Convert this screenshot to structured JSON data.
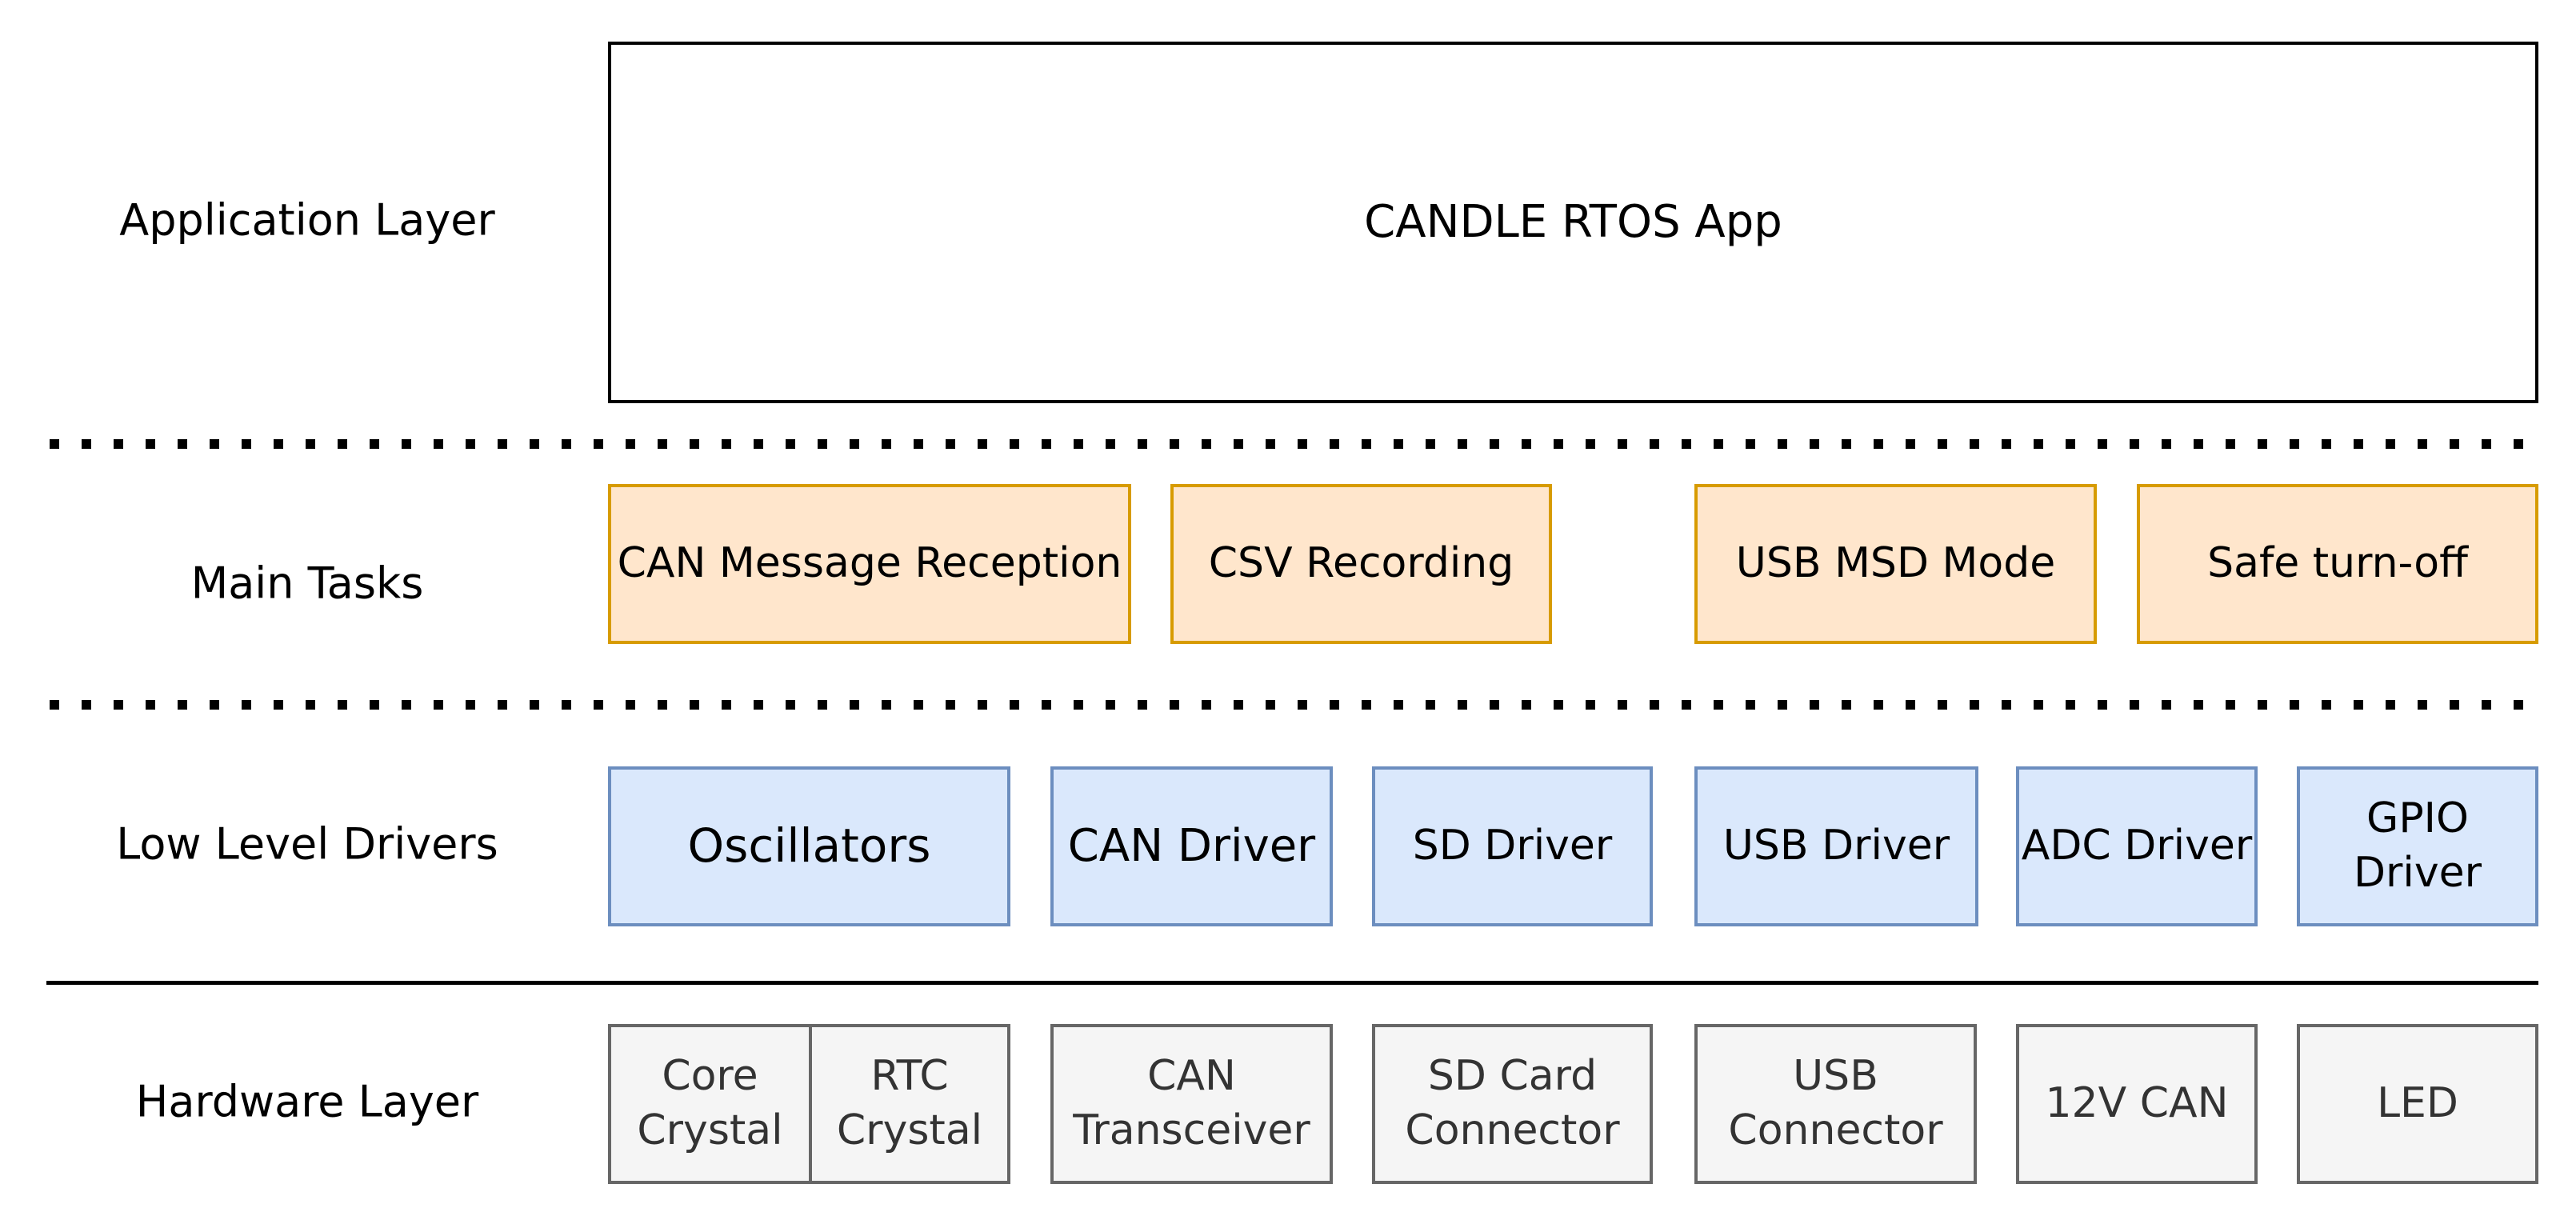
{
  "layers": {
    "application": "Application Layer",
    "tasks": "Main Tasks",
    "drivers": "Low Level Drivers",
    "hardware": "Hardware Layer"
  },
  "app": "CANDLE RTOS App",
  "tasks": [
    "CAN Message Reception",
    "CSV Recording",
    "USB MSD Mode",
    "Safe turn-off"
  ],
  "drivers": [
    "Oscillators",
    "CAN Driver",
    "SD Driver",
    "USB Driver",
    "ADC Driver",
    "GPIO Driver"
  ],
  "hardware": [
    "Core Crystal",
    "RTC Crystal",
    "CAN Transceiver",
    "SD Card Connector",
    "USB Connector",
    "12V CAN",
    "LED"
  ],
  "colors": {
    "task_fill": "#ffe6cc",
    "task_border": "#d79b00",
    "driver_fill": "#dae8fc",
    "driver_border": "#6c8ebf",
    "hardware_fill": "#f5f5f5",
    "hardware_border": "#666666"
  }
}
